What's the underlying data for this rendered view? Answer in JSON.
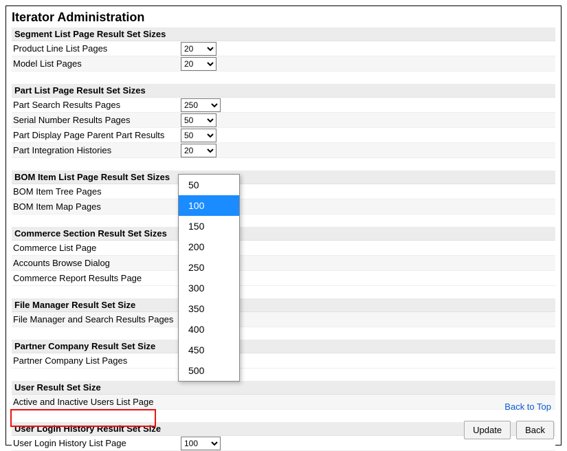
{
  "page": {
    "title": "Iterator Administration"
  },
  "sections": {
    "segment": {
      "header": "Segment List Page Result Set Sizes",
      "rows": [
        {
          "label": "Product Line List Pages",
          "value": "20"
        },
        {
          "label": "Model List Pages",
          "value": "20"
        }
      ]
    },
    "part": {
      "header": "Part List Page Result Set Sizes",
      "rows": [
        {
          "label": "Part Search Results Pages",
          "value": "250"
        },
        {
          "label": "Serial Number Results Pages",
          "value": "50"
        },
        {
          "label": "Part Display Page Parent Part Results",
          "value": "50"
        },
        {
          "label": "Part Integration Histories",
          "value": "20"
        }
      ]
    },
    "bom": {
      "header": "BOM Item List Page Result Set Sizes",
      "rows": [
        {
          "label": "BOM Item Tree Pages",
          "value": ""
        },
        {
          "label": "BOM Item Map Pages",
          "value": ""
        }
      ]
    },
    "commerce": {
      "header": "Commerce Section Result Set Sizes",
      "rows": [
        {
          "label": "Commerce List Page",
          "value": ""
        },
        {
          "label": "Accounts Browse Dialog",
          "value": ""
        },
        {
          "label": "Commerce Report Results Page",
          "value": ""
        }
      ]
    },
    "filemgr": {
      "header": "File Manager Result Set Size",
      "rows": [
        {
          "label": "File Manager and Search Results Pages",
          "value": ""
        }
      ]
    },
    "partner": {
      "header": "Partner Company Result Set Size",
      "rows": [
        {
          "label": "Partner Company List Pages",
          "value": ""
        }
      ]
    },
    "user": {
      "header": "User Result Set Size",
      "rows": [
        {
          "label": "Active and Inactive Users List Page",
          "value": ""
        }
      ]
    },
    "loginhistory": {
      "header": "User Login History Result Set Size",
      "rows": [
        {
          "label": "User Login History List Page",
          "value": "100"
        }
      ]
    }
  },
  "dropdown": {
    "options": [
      "50",
      "100",
      "150",
      "200",
      "250",
      "300",
      "350",
      "400",
      "450",
      "500"
    ],
    "selected": "100"
  },
  "footer": {
    "back_to_top": "Back to Top",
    "update": "Update",
    "back": "Back"
  }
}
